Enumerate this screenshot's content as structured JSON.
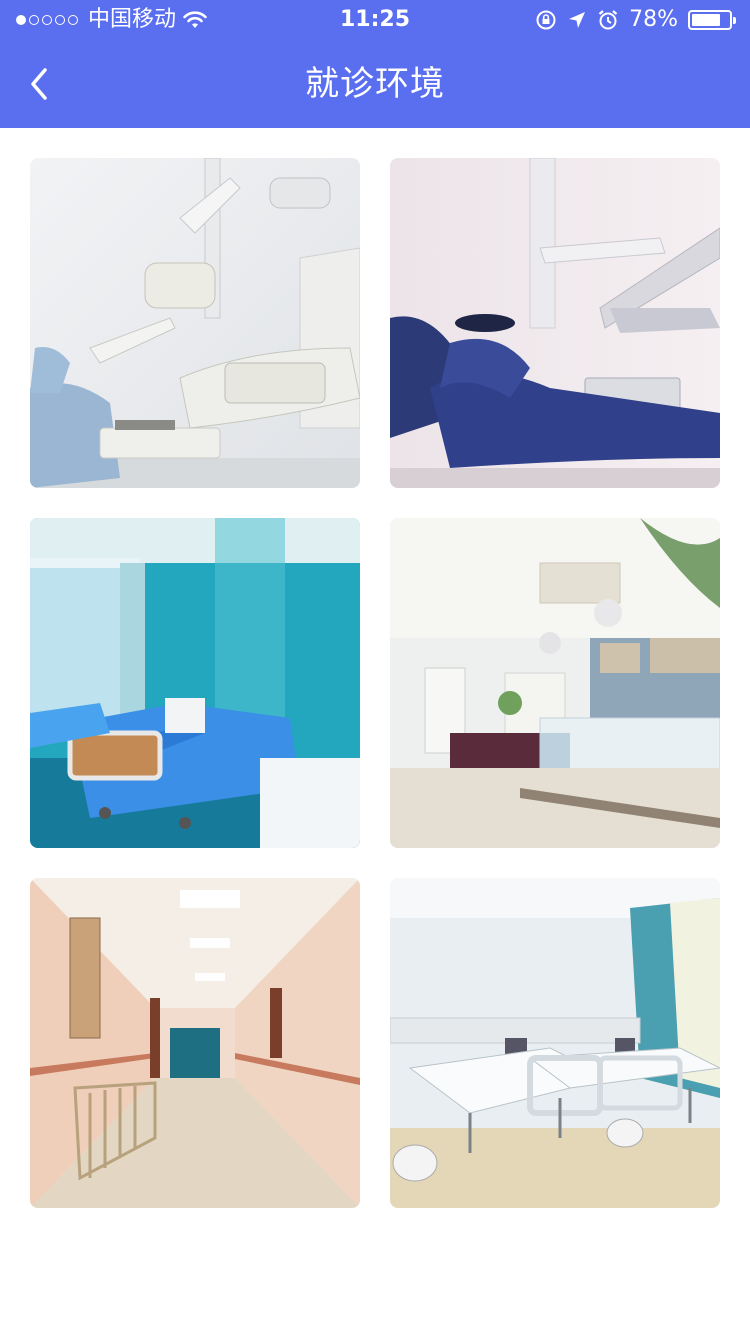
{
  "status_bar": {
    "carrier": "中国移动",
    "time": "11:25",
    "battery": "78%",
    "battery_level": 0.78,
    "signal_bars": 1,
    "signal_total": 5
  },
  "header": {
    "title": "就诊环境",
    "background_color": "#5a6ef0"
  },
  "gallery": {
    "images": [
      {
        "name": "dental-unit-white-photo"
      },
      {
        "name": "dental-chair-navy-photo"
      },
      {
        "name": "blue-hospital-ward-photo"
      },
      {
        "name": "clinic-lobby-photo"
      },
      {
        "name": "hospital-corridor-photo"
      },
      {
        "name": "white-hospital-ward-photo"
      }
    ]
  }
}
